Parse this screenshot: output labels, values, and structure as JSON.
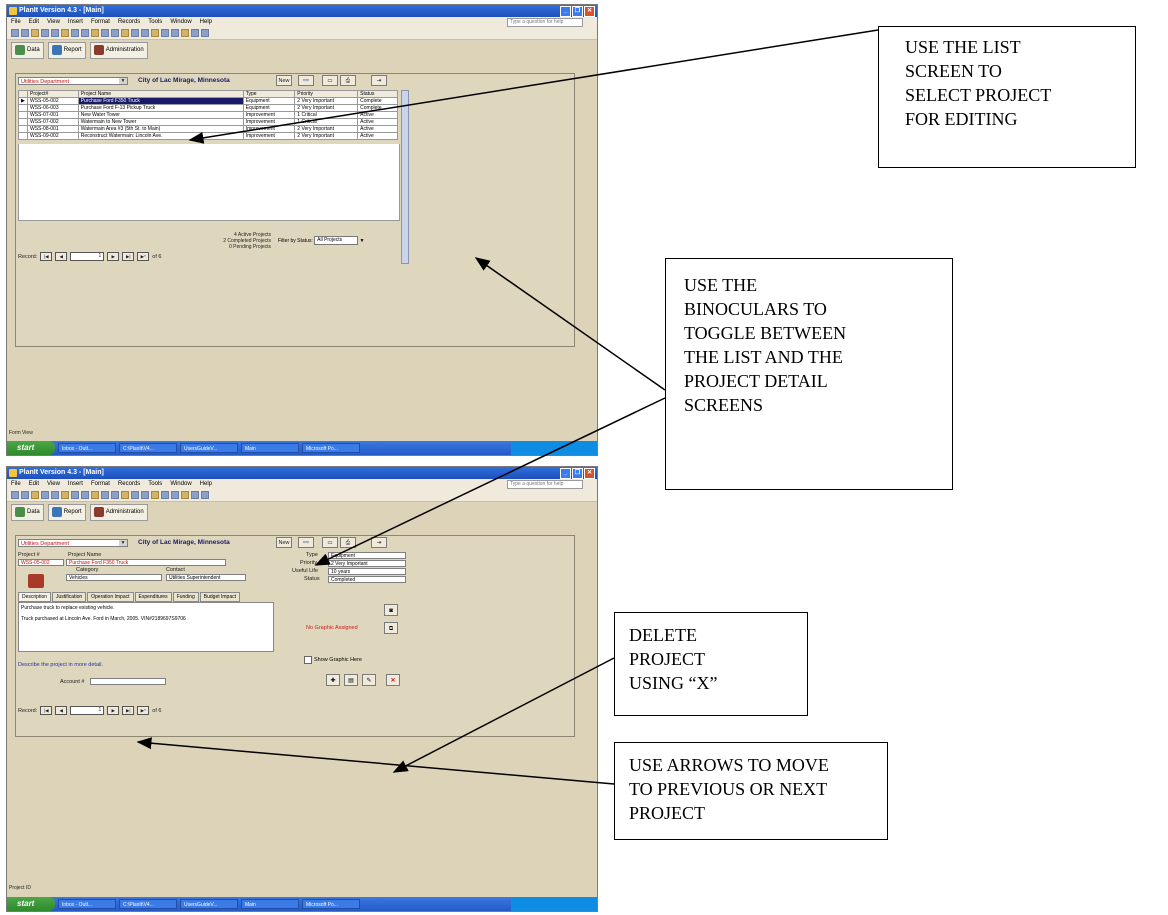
{
  "app": {
    "title": "PlanIt Version 4.3 - [Main]",
    "menu": [
      "File",
      "Edit",
      "View",
      "Insert",
      "Format",
      "Records",
      "Tools",
      "Window",
      "Help"
    ],
    "help_placeholder": "Type a question for help",
    "tabs": [
      "Data",
      "Report",
      "Administration"
    ],
    "department": "Utilities Department",
    "city": "City of Lac Mirage, Minnesota",
    "new_label": "New"
  },
  "list_screen": {
    "columns": [
      "Project#",
      "Project Name",
      "Type",
      "Priority",
      "Status"
    ],
    "rows": [
      [
        "WSS-05-002",
        "Purchase Ford F350 Truck",
        "Equipment",
        "2 Very Important",
        "Complete"
      ],
      [
        "WSS-06-003",
        "Purchase Ford F-13 Pickup Truck",
        "Equipment",
        "2 Very Important",
        "Complete"
      ],
      [
        "WSS-07-001",
        "New Water Tower",
        "Improvement",
        "1 Critical",
        "Active"
      ],
      [
        "WSS-07-002",
        "Watermain to New Tower",
        "Improvement",
        "1 Critical",
        "Active"
      ],
      [
        "WSS-08-001",
        "Watermain Area #3 (5th St. to Main)",
        "Improvement",
        "2 Very Important",
        "Active"
      ],
      [
        "WSS-09-002",
        "Reconstruct Watermain: Lincoln Ave.",
        "Improvement",
        "2 Very Important",
        "Active"
      ]
    ],
    "summary": [
      "4 Active Projects",
      "2 Completed Projects",
      "0 Pending Projects"
    ],
    "filter_label": "Filter by Status",
    "filter_value": "All Projects",
    "record_label": "Record:",
    "record_value": "1",
    "record_of": "of 6",
    "status_bar": "Form View"
  },
  "detail_screen": {
    "project_no_label": "Project #",
    "project_no": "WSS-05-002",
    "project_name_label": "Project Name",
    "project_name": "Purchase Ford F350 Truck",
    "category_label": "Category",
    "category": "Vehicles",
    "contact_label": "Contact",
    "contact": "Utilities Superintendent",
    "type_label": "Type",
    "type": "Equipment",
    "priority_label": "Priority",
    "priority": "2 Very Important",
    "useful_life_label": "Useful Life",
    "useful_life": "10 years",
    "status_label": "Status",
    "status": "Completed",
    "tabs": [
      "Description",
      "Justification",
      "Operation Impact",
      "Expenditures",
      "Funding",
      "Budget Impact"
    ],
    "description_lines": [
      "Purchase truck to replace existing vehicle.",
      "Truck purchased at Lincoln Ave. Ford in March, 2005. VIN#2189697S9706"
    ],
    "no_graphic": "No Graphic Assigned",
    "hint": "Describe the project in more detail.",
    "account_label": "Account #",
    "show_graphic_label": "Show Graphic Here",
    "record_label": "Record:",
    "record_value": "1",
    "record_of": "of 6",
    "status_bar": "Project ID"
  },
  "taskbar": {
    "start": "start",
    "items": [
      "Inbox - Outl...",
      "C:\\PlanIt\\V4...",
      "UsersGuideV...",
      "Main",
      "Microsoft Po..."
    ]
  },
  "callouts": {
    "list": [
      "USE THE LIST",
      "SCREEN TO",
      "SELECT PROJECT",
      "FOR EDITING"
    ],
    "binoculars": [
      "USE THE",
      "BINOCULARS TO",
      "TOGGLE BETWEEN",
      "THE LIST AND THE",
      "PROJECT DETAIL",
      "SCREENS"
    ],
    "delete": [
      "DELETE",
      "PROJECT",
      "USING  “X”"
    ],
    "arrows": [
      "USE ARROWS TO MOVE",
      "TO PREVIOUS OR NEXT",
      "PROJECT"
    ]
  }
}
